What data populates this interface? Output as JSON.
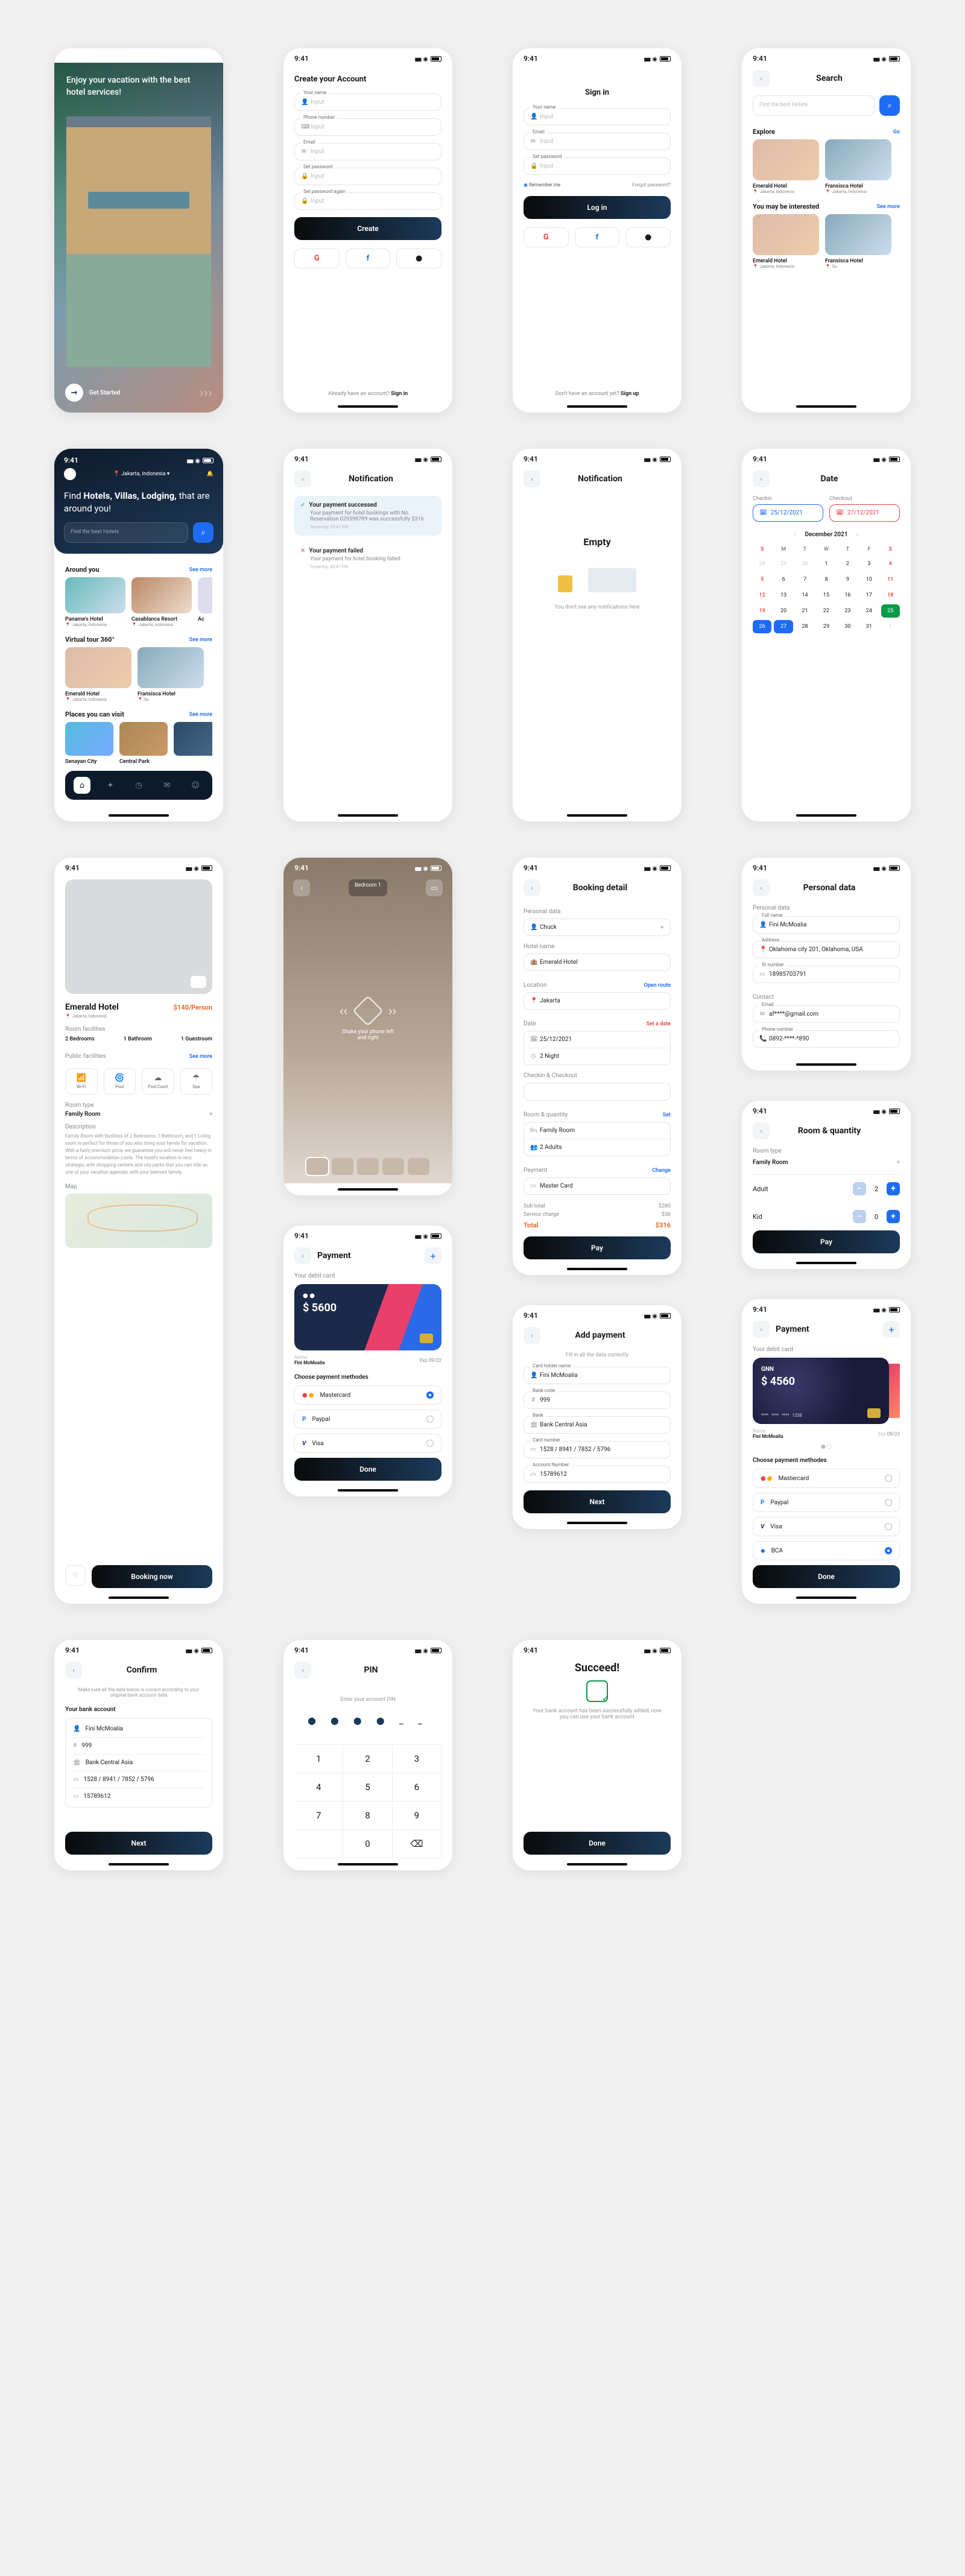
{
  "time": "9:41",
  "hero": {
    "tagline": "Enjoy your vacation with the best hotel services!",
    "cta": "Get Started"
  },
  "signup": {
    "title": "Create your Account",
    "fields": {
      "name": "Your name",
      "name_ph": "Input",
      "phone": "Phone number",
      "phone_ph": "Input",
      "email": "Email",
      "email_ph": "Input",
      "pass": "Set password",
      "pass_ph": "Input",
      "pass2": "Set password again",
      "pass2_ph": "Input"
    },
    "cta": "Create",
    "foot": "Already have an account? ",
    "foot_b": "Sign in"
  },
  "signin": {
    "title": "Sign in",
    "name": "Your name",
    "email": "Email",
    "pass": "Set password",
    "ph": "Input",
    "remember": "Remember me",
    "forgot": "Forgot password?",
    "cta": "Log in",
    "foot": "Don't have an account yet? ",
    "foot_b": "Sign up"
  },
  "search": {
    "title": "Search",
    "ph": "Find the best Hotels",
    "explore": "Explore",
    "interest": "You may be interested",
    "go": "Go",
    "see": "See more",
    "c1": "Emerald Hotel",
    "c2": "Fransisca Hotel",
    "loc": "Jakarta, Indonesia"
  },
  "home": {
    "loc": "Jakarta, Indonesia",
    "heading_a": "Find ",
    "heading_b": "Hotels, Villas, Lodging,",
    "heading_c": " that are around you!",
    "around": "Around you",
    "tour": "Virtual tour 360°",
    "places": "Places you can visit",
    "see": "See more",
    "h1": "Paname's Hotel",
    "h2": "Casablanca Resort",
    "h3": "Ac",
    "e1": "Emerald Hotel",
    "e2": "Fransisca Hotel",
    "p1": "Senayan City",
    "p2": "Central Park"
  },
  "noti": {
    "title": "Notification",
    "ok_t": "Your payment successed",
    "ok_b": "Your payment for hotel bookings with No. Reservation 0293987R9 was successfully $316",
    "ok_time": "Yesterday, 09:41 PM",
    "bad_t": "Your payment failed",
    "bad_b": "Your payment for hotel booking failed",
    "bad_time": "Yesterday, 09:41 PM",
    "empty_t": "Empty",
    "empty_s": "You don't see any notifications here"
  },
  "date": {
    "title": "Date",
    "cin": "Checkin",
    "cout": "Checkout",
    "cin_v": "25/12/2021",
    "cout_v": "27/12/2021",
    "month": "December 2021",
    "days": [
      "S",
      "M",
      "T",
      "W",
      "T",
      "F",
      "S"
    ]
  },
  "booking": {
    "title": "Booking detail",
    "pd": "Personal data",
    "chuck": "Chuck",
    "hn": "Hotel name",
    "hn_v": "Emerald Hotel",
    "loc": "Location",
    "open": "Open route",
    "loc_v": "Jakarta",
    "dt": "Date",
    "set": "Set a date",
    "dt_v": "25/12/2021",
    "ng": "2 Night",
    "cc": "Checkin & Checkout",
    "rq": "Room & quantity",
    "rq_set": "Set",
    "rq_v": "Family Room",
    "rq_p": "2 Adults",
    "pay": "Payment",
    "change": "Change",
    "pay_v": "Master Card",
    "sub": "Sub total",
    "sub_v": "$280",
    "sc": "Service charge",
    "sc_v": "$36",
    "tot": "Total",
    "tot_v": "$316",
    "cta": "Pay"
  },
  "personal": {
    "title": "Personal data",
    "pd": "Personal data",
    "name_l": "Full name",
    "name": "Fini McMoalia",
    "addr_l": "Address",
    "addr": "Oklahoma city 201, Oklahoma, USA",
    "id_l": "ID number",
    "id": "18985703791",
    "con": "Contact",
    "em_l": "Email",
    "em": "af****@gmail.com",
    "ph_l": "Phone number",
    "ph": "0892-****-*890"
  },
  "rq": {
    "title": "Room & quantity",
    "type_l": "Room type",
    "type": "Family Room",
    "adult": "Adult",
    "adult_n": "2",
    "kid": "Kid",
    "kid_n": "0",
    "cta": "Pay"
  },
  "pay1": {
    "title": "Payment",
    "card_l": "Your debit card",
    "amt": "$ 5600",
    "name_l": "Name",
    "name": "Fini McMoalia",
    "exp": "Exp 09/22",
    "choose": "Choose payment methodes",
    "m1": "Mastercard",
    "m2": "Paypal",
    "m3": "Visa",
    "cta": "Done"
  },
  "pay2": {
    "title": "Payment",
    "card_l": "Your debit card",
    "brand": "GNN",
    "amt": "$ 4560",
    "exp_l": "Exp",
    "exp": "08/23",
    "name_l": "Name",
    "name": "Fini McMoalia",
    "choose": "Choose payment methodes",
    "m1": "Mastercard",
    "m2": "Paypal",
    "m3": "Visa",
    "m4": "BCA",
    "cta": "Done"
  },
  "addpay": {
    "title": "Add payment",
    "sub": "Fill in all the data correctly",
    "f1": "Card holder name",
    "f1v": "Fini McMoalia",
    "f2": "Bank code",
    "f2v": "999",
    "f3": "Bank",
    "f3v": "Bank Central Asia",
    "f4": "Card number",
    "f4v": "1528 / 8941 / 7852 / 5796",
    "f5": "Account Number",
    "f5v": "15789612",
    "cta": "Next"
  },
  "confirm": {
    "title": "Confirm",
    "sub": "Make sure all the data below is correct according to your original bank account data",
    "h": "Your bank account",
    "name": "Fini McMoalia",
    "code": "999",
    "bank": "Bank Central Asia",
    "card": "1528 / 8941 / 7852 / 5796",
    "acct": "15789612",
    "cta": "Next"
  },
  "pin": {
    "title": "PIN",
    "sub": "Enter your account PIN",
    "del": "⌫"
  },
  "succeed": {
    "title": "Succeed!",
    "msg": "Your bank account has been successfully added, now you can use your bank account",
    "cta": "Done"
  },
  "detail": {
    "name": "Emerald Hotel",
    "price": "$140/Person",
    "loc": "Jakarta, Indonesia",
    "rf": "Room facilities",
    "rf1": "2 Bedrooms",
    "rf2": "1 Bathroom",
    "rf3": "1 Guestroom",
    "pf": "Public facilities",
    "pf1": "Wi-Fi",
    "pf2": "Pool",
    "pf3": "Pool Court",
    "pf4": "Spa",
    "rt_l": "Room type",
    "rt": "Family Room",
    "dl": "Description",
    "desc": "Family Room with facilities of 2 Bedrooms, 1 Bathroom, and 1 Living room is perfect for those of you who bring your family for vacation. With a fairly premium price, we guarantee you will never feel heavy in terms of accommodation costs. The hotel's location is very strategic, with shopping centers and city parks that you can ride as one of your vacation agendas with your beloved family.",
    "see": "See more",
    "map_l": "Map",
    "cta": "Booking now"
  },
  "vr": {
    "room": "Bedroom 1",
    "hint": "Shake your phone left and right"
  }
}
